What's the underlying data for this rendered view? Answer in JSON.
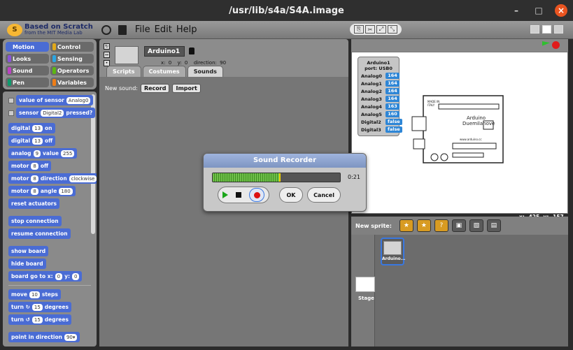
{
  "window": {
    "title": "/usr/lib/s4a/S4A.image"
  },
  "menubar": {
    "logo_line1": "Based on Scratch",
    "logo_line2": "from the MIT Media Lab",
    "menus": [
      "File",
      "Edit",
      "Help"
    ]
  },
  "categories": [
    {
      "label": "Motion",
      "color": "#4a6cd4"
    },
    {
      "label": "Control",
      "color": "#e1a91a"
    },
    {
      "label": "Looks",
      "color": "#8a55d7"
    },
    {
      "label": "Sensing",
      "color": "#2ca5e2"
    },
    {
      "label": "Sound",
      "color": "#bb42c3"
    },
    {
      "label": "Operators",
      "color": "#5cb712"
    },
    {
      "label": "Pen",
      "color": "#0e9a6c"
    },
    {
      "label": "Variables",
      "color": "#ee7d16"
    }
  ],
  "blocks": {
    "value_of_sensor": {
      "text": "value of sensor",
      "input": "Analog0"
    },
    "sensor_pressed": {
      "pre": "sensor",
      "input": "Digital2",
      "post": "pressed?"
    },
    "digital_on": {
      "pre": "digital",
      "input": "13",
      "post": "on"
    },
    "digital_off": {
      "pre": "digital",
      "input": "13",
      "post": "off"
    },
    "analog_value": {
      "pre": "analog",
      "input": "9",
      "mid": "value",
      "input2": "255"
    },
    "motor_off": {
      "pre": "motor",
      "input": "8",
      "post": "off"
    },
    "motor_direction": {
      "pre": "motor",
      "input": "8",
      "mid": "direction",
      "input2": "clockwise"
    },
    "motor_angle": {
      "pre": "motor",
      "input": "8",
      "mid": "angle",
      "input2": "180"
    },
    "reset_actuators": "reset actuators",
    "stop_connection": "stop connection",
    "resume_connection": "resume connection",
    "show_board": "show board",
    "hide_board": "hide board",
    "board_go_to": {
      "pre": "board go to x:",
      "x": "0",
      "mid": "y:",
      "y": "0"
    },
    "move_steps": {
      "pre": "move",
      "input": "10",
      "post": "steps"
    },
    "turn_cw": {
      "pre": "turn ↻",
      "input": "15",
      "post": "degrees"
    },
    "turn_ccw": {
      "pre": "turn ↺",
      "input": "15",
      "post": "degrees"
    },
    "point_direction": {
      "pre": "point in direction",
      "input": "90▾"
    }
  },
  "sprite": {
    "name": "Arduino1",
    "x_label": "x:",
    "x": "0",
    "y_label": "y:",
    "y": "0",
    "direction_label": "direction:",
    "direction": "90"
  },
  "tabs": [
    "Scripts",
    "Costumes",
    "Sounds"
  ],
  "sounds_tab": {
    "new_sound_label": "New sound:",
    "record_button": "Record",
    "import_button": "Import"
  },
  "sensor_board": {
    "title": "Arduino1",
    "port": "port: USB0",
    "rows": [
      {
        "name": "Analog0",
        "value": "164"
      },
      {
        "name": "Analog1",
        "value": "164"
      },
      {
        "name": "Analog2",
        "value": "164"
      },
      {
        "name": "Analog3",
        "value": "164"
      },
      {
        "name": "Analog4",
        "value": "163"
      },
      {
        "name": "Analog5",
        "value": "160"
      },
      {
        "name": "Digital2",
        "value": "false"
      },
      {
        "name": "Digital3",
        "value": "false"
      }
    ]
  },
  "stage_drawing": {
    "label1": "Arduino",
    "label2": "Duemilanove",
    "label3": "www.arduino.cc",
    "label4": "MADE IN",
    "label5": "ITALY"
  },
  "stage_coords": {
    "x_label": "x:",
    "x": "-425",
    "y_label": "y:",
    "y": "-157"
  },
  "new_sprite": {
    "label": "New sprite:"
  },
  "sprite_list": {
    "stage_label": "Stage",
    "sprites": [
      {
        "name": "Arduino..."
      }
    ]
  },
  "sound_recorder": {
    "title": "Sound Recorder",
    "time": "0:21",
    "level": 0.52,
    "ok_button": "OK",
    "cancel_button": "Cancel"
  }
}
